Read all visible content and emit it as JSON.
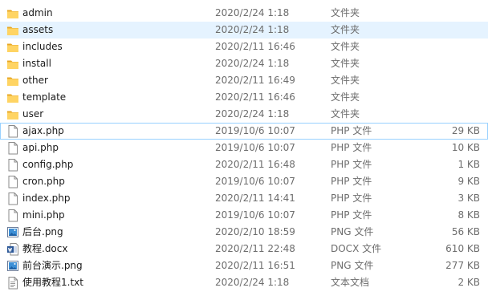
{
  "files": [
    {
      "name": "admin",
      "date": "2020/2/24 1:18",
      "type": "文件夹",
      "size": "",
      "icon": "folder-icon"
    },
    {
      "name": "assets",
      "date": "2020/2/24 1:18",
      "type": "文件夹",
      "size": "",
      "icon": "folder-icon",
      "selected": true
    },
    {
      "name": "includes",
      "date": "2020/2/11 16:46",
      "type": "文件夹",
      "size": "",
      "icon": "folder-icon"
    },
    {
      "name": "install",
      "date": "2020/2/24 1:18",
      "type": "文件夹",
      "size": "",
      "icon": "folder-icon"
    },
    {
      "name": "other",
      "date": "2020/2/11 16:49",
      "type": "文件夹",
      "size": "",
      "icon": "folder-icon"
    },
    {
      "name": "template",
      "date": "2020/2/11 16:46",
      "type": "文件夹",
      "size": "",
      "icon": "folder-icon"
    },
    {
      "name": "user",
      "date": "2020/2/24 1:18",
      "type": "文件夹",
      "size": "",
      "icon": "folder-icon"
    },
    {
      "name": "ajax.php",
      "date": "2019/10/6 10:07",
      "type": "PHP 文件",
      "size": "29 KB",
      "icon": "php-file-icon",
      "focused": true
    },
    {
      "name": "api.php",
      "date": "2019/10/6 10:07",
      "type": "PHP 文件",
      "size": "10 KB",
      "icon": "php-file-icon"
    },
    {
      "name": "config.php",
      "date": "2020/2/11 16:48",
      "type": "PHP 文件",
      "size": "1 KB",
      "icon": "php-file-icon"
    },
    {
      "name": "cron.php",
      "date": "2019/10/6 10:07",
      "type": "PHP 文件",
      "size": "9 KB",
      "icon": "php-file-icon"
    },
    {
      "name": "index.php",
      "date": "2020/2/11 14:41",
      "type": "PHP 文件",
      "size": "3 KB",
      "icon": "php-file-icon"
    },
    {
      "name": "mini.php",
      "date": "2019/10/6 10:07",
      "type": "PHP 文件",
      "size": "8 KB",
      "icon": "php-file-icon"
    },
    {
      "name": "后台.png",
      "date": "2020/2/10 18:59",
      "type": "PNG 文件",
      "size": "56 KB",
      "icon": "png-image-icon"
    },
    {
      "name": "教程.docx",
      "date": "2020/2/11 22:48",
      "type": "DOCX 文件",
      "size": "610 KB",
      "icon": "docx-file-icon"
    },
    {
      "name": "前台演示.png",
      "date": "2020/2/11 16:51",
      "type": "PNG 文件",
      "size": "277 KB",
      "icon": "png-image-icon"
    },
    {
      "name": "使用教程1.txt",
      "date": "2020/2/24 1:18",
      "type": "文本文档",
      "size": "2 KB",
      "icon": "text-file-icon"
    }
  ]
}
